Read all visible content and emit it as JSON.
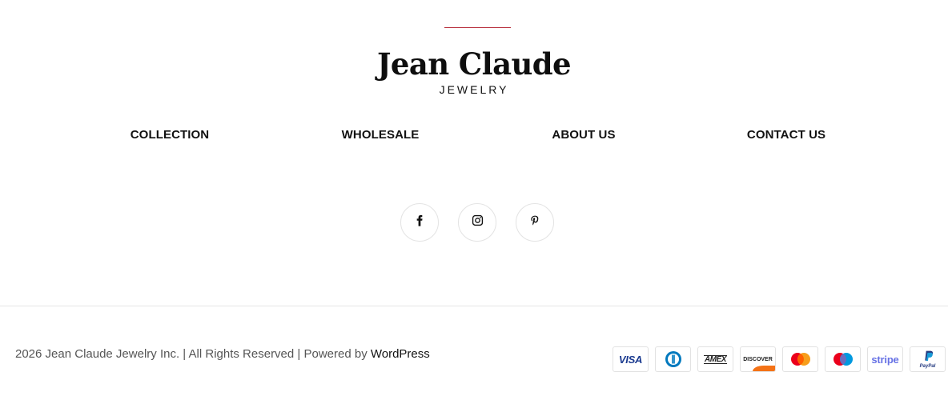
{
  "brand": {
    "name": "Jean Claude",
    "tagline": "JEWELRY",
    "accent_color": "#b8323f"
  },
  "nav": {
    "items": [
      {
        "label": "COLLECTION"
      },
      {
        "label": "WHOLESALE"
      },
      {
        "label": "ABOUT US"
      },
      {
        "label": "CONTACT US"
      }
    ]
  },
  "socials": [
    {
      "icon": "facebook-icon"
    },
    {
      "icon": "instagram-icon"
    },
    {
      "icon": "pinterest-icon"
    }
  ],
  "footer": {
    "copyright_prefix": "2026 Jean Claude Jewelry Inc. | All Rights Reserved | Powered by ",
    "powered_link": "WordPress"
  },
  "payments": [
    {
      "name": "VISA",
      "icon": "visa-icon"
    },
    {
      "name": "Diners Club",
      "icon": "diners-club-icon"
    },
    {
      "name": "AMEX",
      "icon": "amex-icon"
    },
    {
      "name": "DISCOVER",
      "icon": "discover-icon"
    },
    {
      "name": "Mastercard",
      "icon": "mastercard-icon"
    },
    {
      "name": "Maestro",
      "icon": "maestro-icon"
    },
    {
      "name": "stripe",
      "icon": "stripe-icon"
    },
    {
      "name": "PayPal",
      "icon": "paypal-icon"
    }
  ]
}
